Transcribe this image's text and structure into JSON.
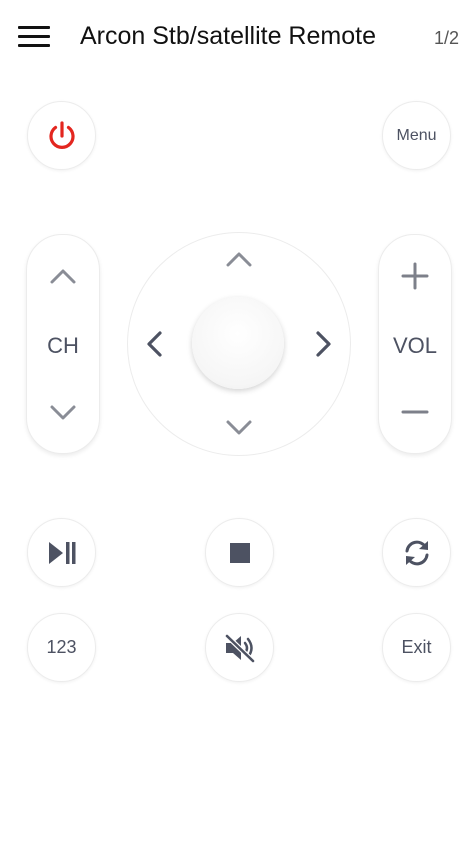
{
  "header": {
    "title": "Arcon Stb/satellite Remote",
    "page_indicator": "1/2"
  },
  "colors": {
    "power_red": "#e3261f",
    "icon_gray": "#4d5262",
    "arrow_gray": "#8a8d96"
  },
  "buttons": {
    "menu_label": "Menu",
    "channel_label": "CH",
    "volume_label": "VOL",
    "numbers_label": "123",
    "exit_label": "Exit"
  },
  "icons": {
    "power": "power-icon",
    "play_pause": "play-pause-icon",
    "stop": "stop-icon",
    "refresh": "refresh-icon",
    "mute": "mute-icon"
  }
}
